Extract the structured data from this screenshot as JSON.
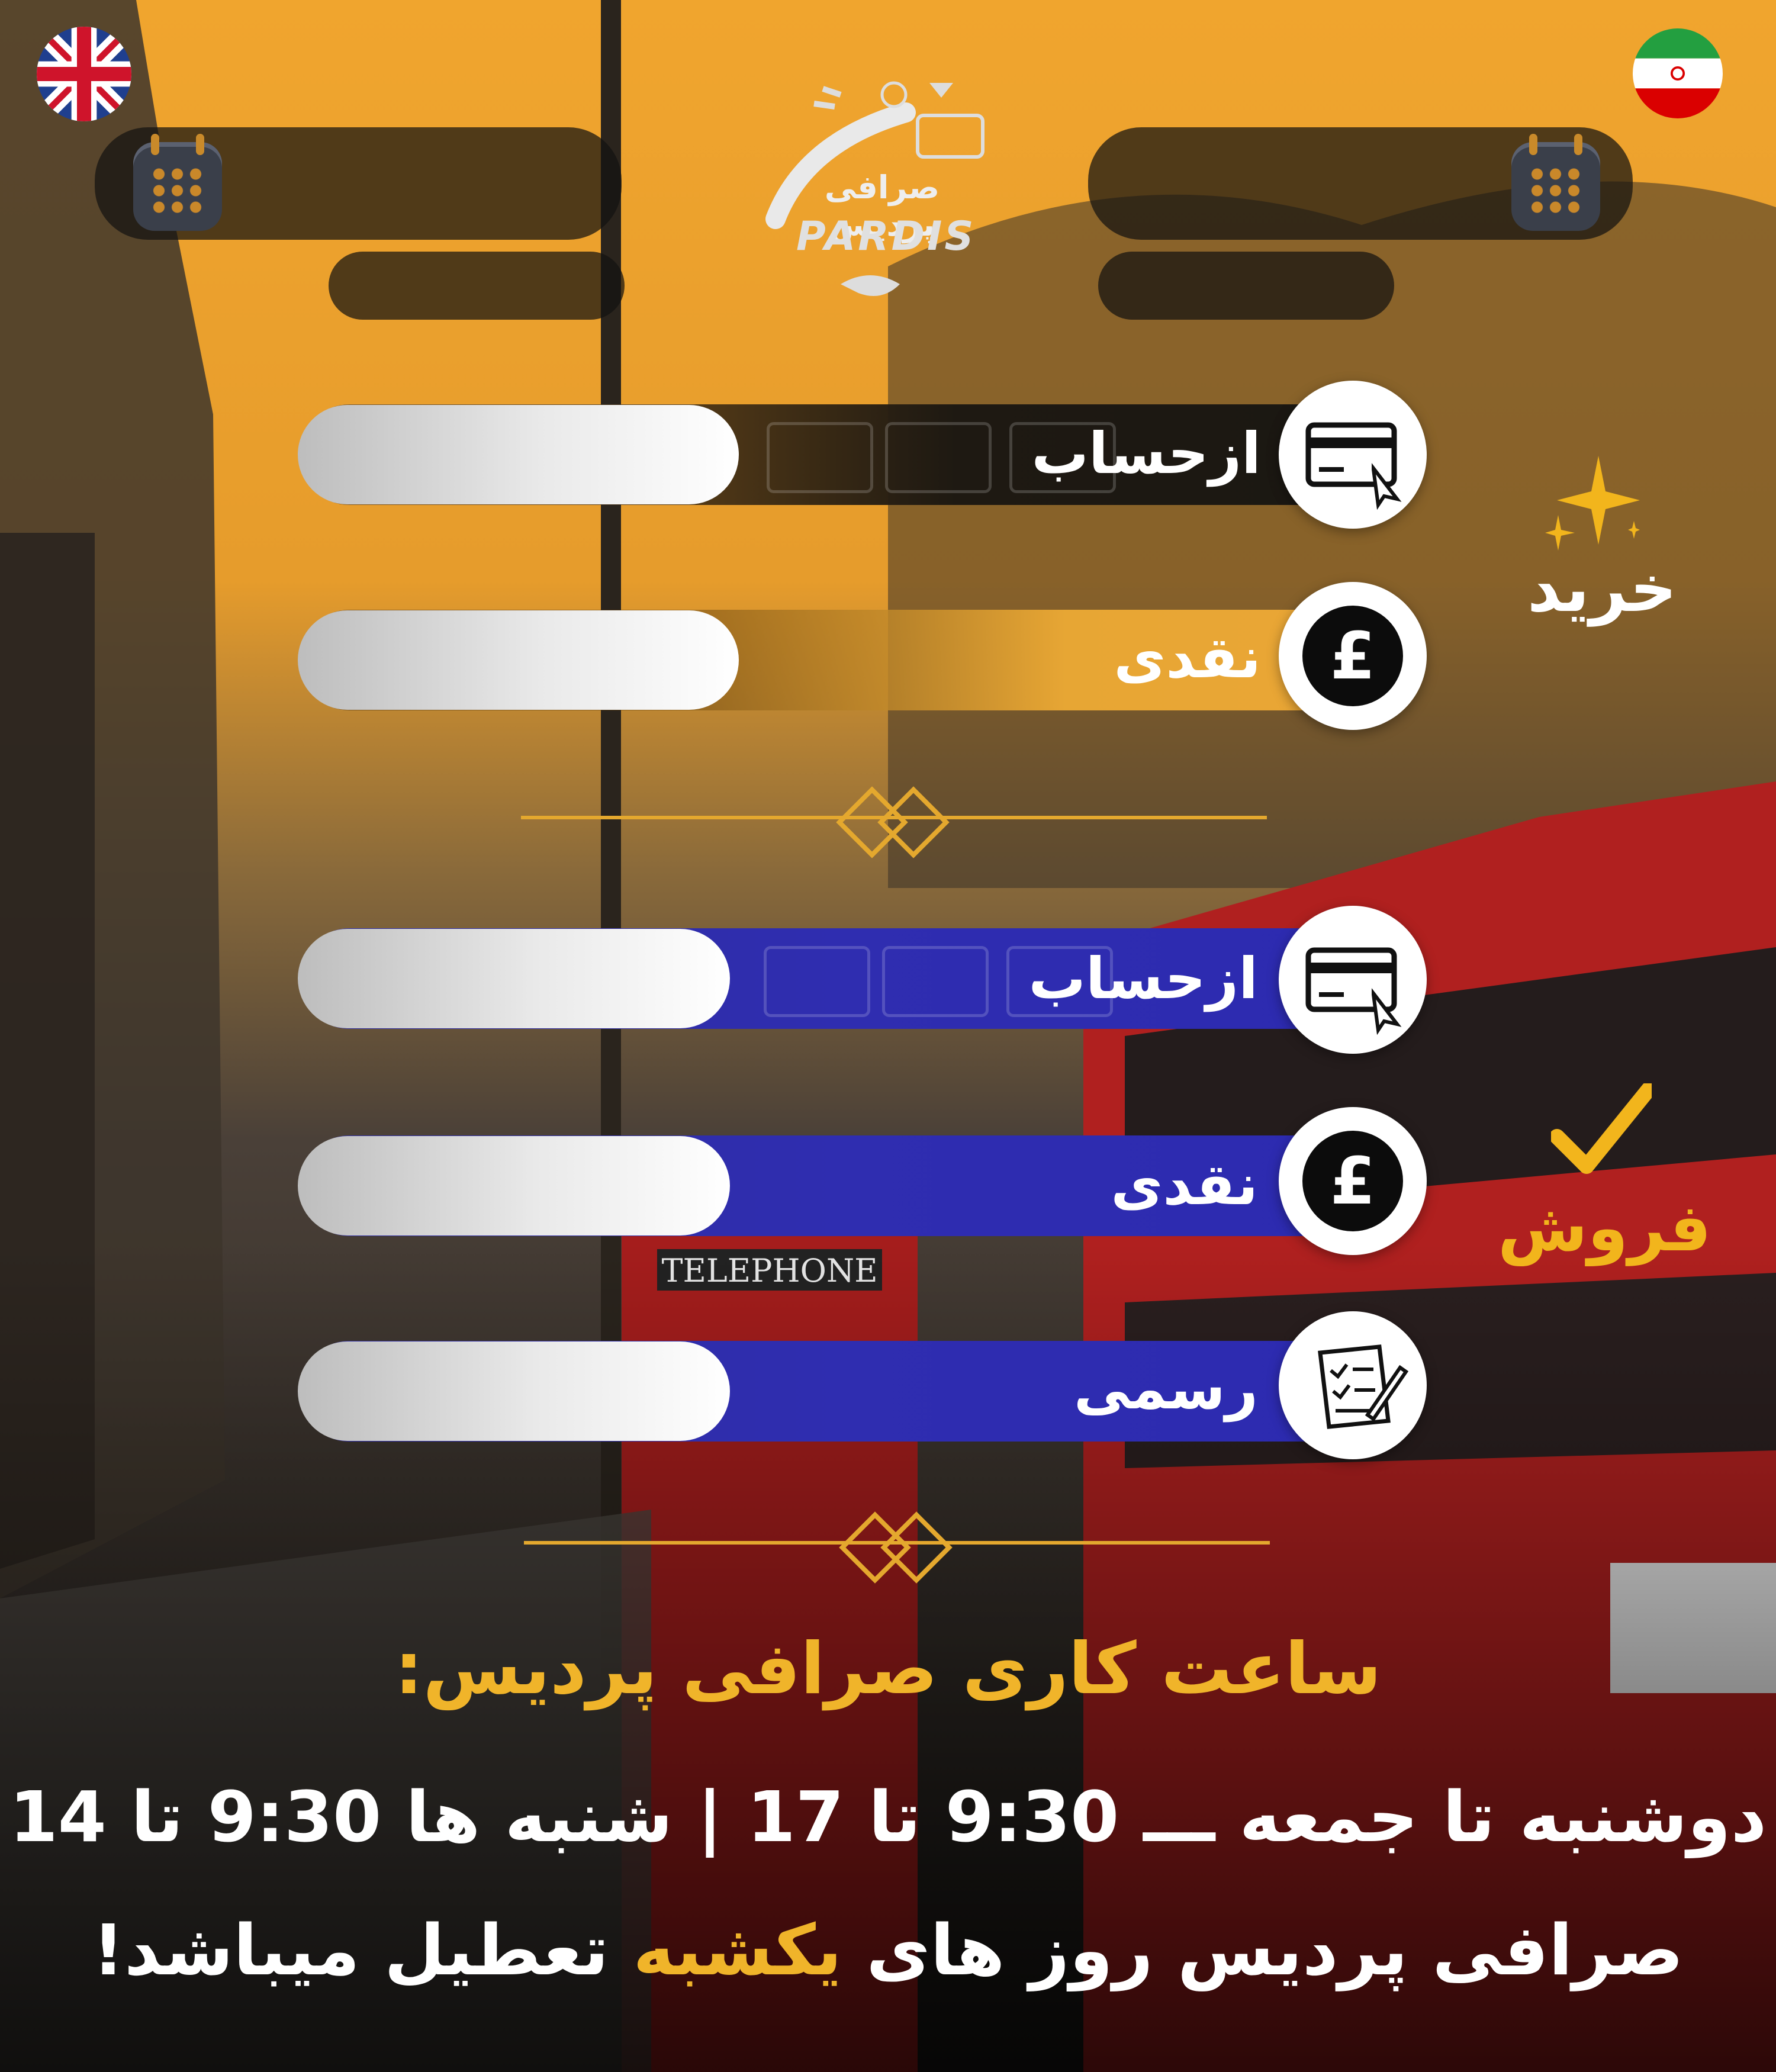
{
  "logo": {
    "fa_name": "صرافی پردیس",
    "en_name": "PARDIS"
  },
  "flags": {
    "left": "uk-flag",
    "right": "iran-flag"
  },
  "buy": {
    "title": "خرید",
    "rows": [
      {
        "label": "ازحساب",
        "icon": "credit-card-icon"
      },
      {
        "label": "نقدی",
        "icon": "pound-icon",
        "icon_glyph": "£"
      }
    ]
  },
  "sell": {
    "title": "فروش",
    "rows": [
      {
        "label": "ازحساب",
        "icon": "credit-card-icon"
      },
      {
        "label": "نقدی",
        "icon": "pound-icon",
        "icon_glyph": "£"
      },
      {
        "label": "رسمی",
        "icon": "form-checklist-icon"
      }
    ]
  },
  "hours": {
    "title": "ساعت کاری صرافی پردیس:",
    "line1": "دوشنبه تا جمعه ـــ 9:30 تا 17 | شنبه ها 9:30 تا 14",
    "line2_prefix": "صرافی پردیس روز های",
    "line2_highlight": "یکشبه",
    "line2_suffix": "تعطیل میباشد!"
  },
  "colors": {
    "accent": "#f0b42a",
    "sell_bar": "#2f2db0",
    "buy_bar": "#1e1912"
  }
}
